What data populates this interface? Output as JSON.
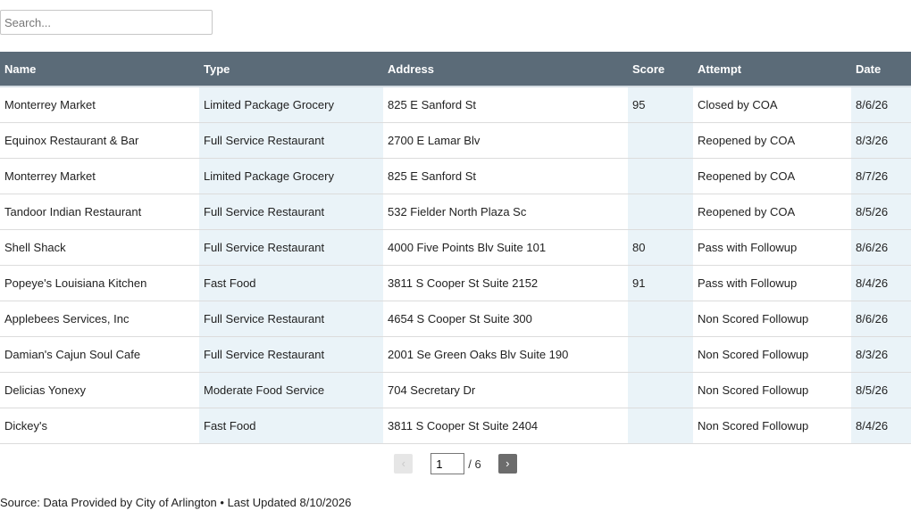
{
  "search": {
    "placeholder": "Search..."
  },
  "table": {
    "columns": [
      "Name",
      "Type",
      "Address",
      "Score",
      "Attempt",
      "Date"
    ],
    "rows": [
      [
        "Monterrey Market",
        "Limited Package Grocery",
        "825 E Sanford St",
        "95",
        "Closed by COA",
        "8/6/26"
      ],
      [
        "Equinox Restaurant & Bar",
        "Full Service Restaurant",
        "2700 E Lamar Blv",
        "",
        "Reopened by COA",
        "8/3/26"
      ],
      [
        "Monterrey Market",
        "Limited Package Grocery",
        "825 E Sanford St",
        "",
        "Reopened by COA",
        "8/7/26"
      ],
      [
        "Tandoor Indian Restaurant",
        "Full Service Restaurant",
        "532 Fielder North Plaza Sc",
        "",
        "Reopened by COA",
        "8/5/26"
      ],
      [
        "Shell Shack",
        "Full Service Restaurant",
        "4000 Five Points Blv Suite 101",
        "80",
        "Pass with Followup",
        "8/6/26"
      ],
      [
        "Popeye's Louisiana Kitchen",
        "Fast Food",
        "3811 S Cooper St Suite 2152",
        "91",
        "Pass with Followup",
        "8/4/26"
      ],
      [
        "Applebees Services, Inc",
        "Full Service Restaurant",
        "4654 S Cooper St Suite 300",
        "",
        "Non Scored Followup",
        "8/6/26"
      ],
      [
        "Damian's Cajun Soul Cafe",
        "Full Service Restaurant",
        "2001 Se Green Oaks Blv Suite 190",
        "",
        "Non Scored Followup",
        "8/3/26"
      ],
      [
        "Delicias Yonexy",
        "Moderate Food Service",
        "704 Secretary Dr",
        "",
        "Non Scored Followup",
        "8/5/26"
      ],
      [
        "Dickey's",
        "Fast Food",
        "3811 S Cooper St Suite 2404",
        "",
        "Non Scored Followup",
        "8/4/26"
      ]
    ]
  },
  "pagination": {
    "prev_label": "‹",
    "next_label": "›",
    "current_page": "1",
    "total_label": "/ 6"
  },
  "footer": {
    "source": "Source: Data Provided by City of Arlington • Last Updated 8/10/2026"
  },
  "colors": {
    "header_bg": "#5b6b78",
    "shaded_column": "#eaf3f8",
    "next_button": "#6c6c6c"
  }
}
